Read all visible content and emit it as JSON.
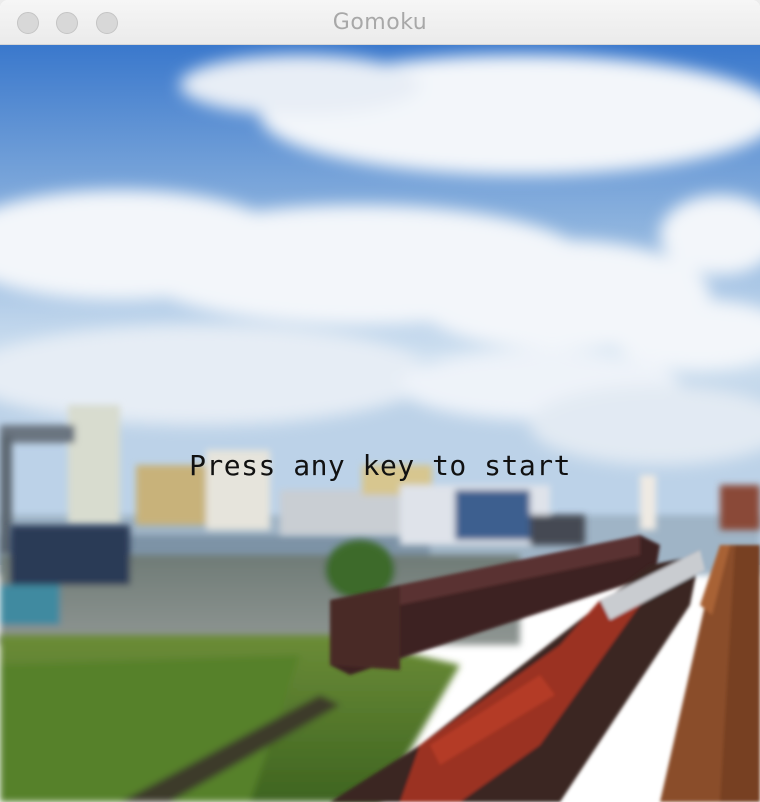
{
  "window": {
    "title": "Gomoku"
  },
  "game": {
    "prompt": "Press any key to start"
  },
  "colors": {
    "sky_top": "#3f7fd0",
    "sky_bottom": "#cfe0f0",
    "grass": "#4f7a2a",
    "train_red": "#9b3322",
    "train_rust": "#8a4d2a",
    "train_dark": "#3d2422",
    "prompt_text": "#111111"
  },
  "icons": [
    "close-button",
    "minimize-button",
    "zoom-button"
  ]
}
